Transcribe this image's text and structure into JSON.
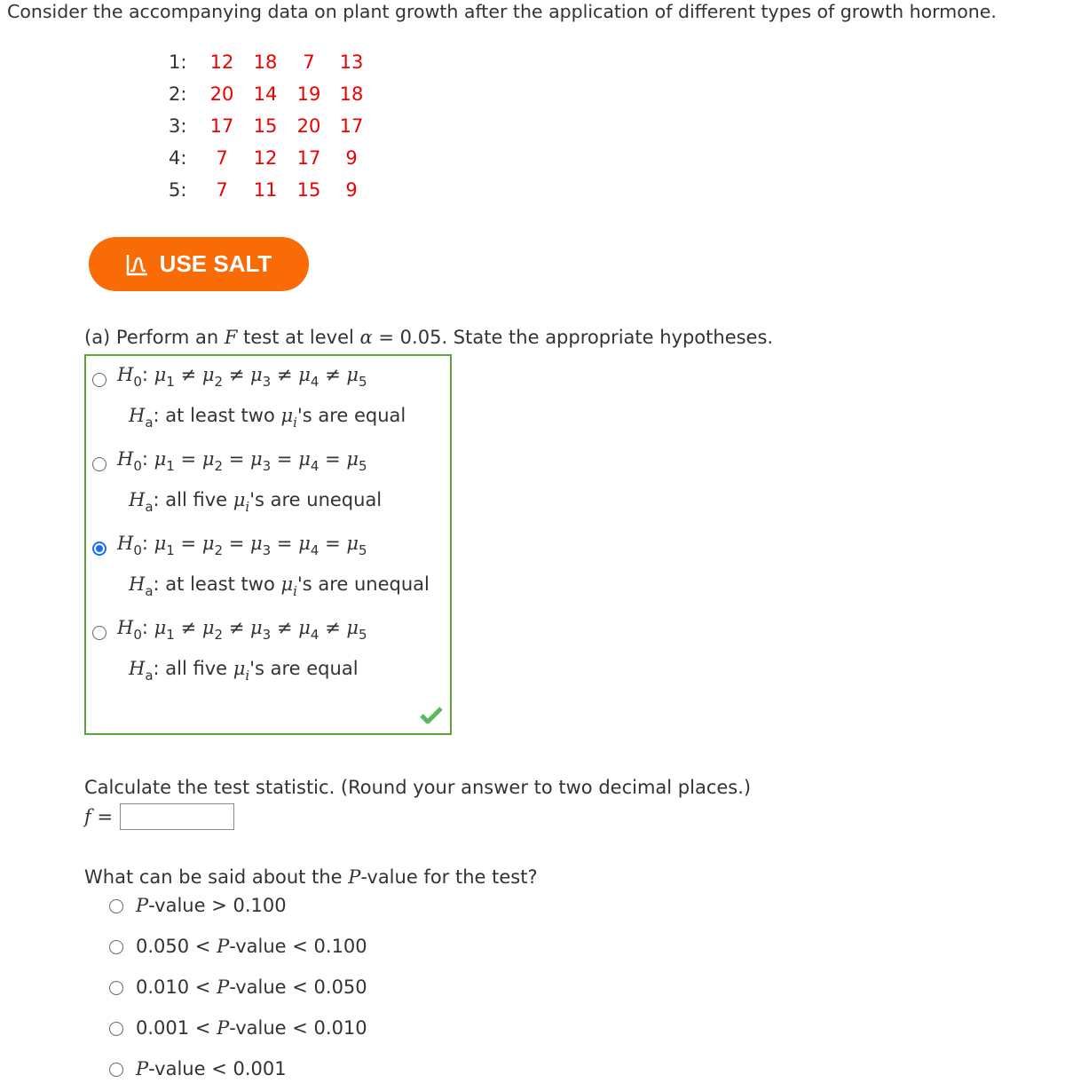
{
  "intro": "Consider the accompanying data on plant growth after the application of different types of growth hormone.",
  "table": [
    {
      "label": "1:",
      "values": [
        "12",
        "18",
        "7",
        "13"
      ]
    },
    {
      "label": "2:",
      "values": [
        "20",
        "14",
        "19",
        "18"
      ]
    },
    {
      "label": "3:",
      "values": [
        "17",
        "15",
        "20",
        "17"
      ]
    },
    {
      "label": "4:",
      "values": [
        "7",
        "12",
        "17",
        "9"
      ]
    },
    {
      "label": "5:",
      "values": [
        "7",
        "11",
        "15",
        "9"
      ]
    }
  ],
  "salt_button": "USE SALT",
  "part_a": {
    "prompt_pre": "(a) Perform an ",
    "prompt_f": "F",
    "prompt_mid": " test at level ",
    "alpha": "α",
    "prompt_post": " = 0.05. State the appropriate hypotheses.",
    "options": [
      {
        "rel": "≠",
        "ha_pre": "at least two ",
        "ha_post": "'s are equal",
        "selected": false
      },
      {
        "rel": "=",
        "ha_pre": "all five ",
        "ha_post": "'s are unequal",
        "selected": false
      },
      {
        "rel": "=",
        "ha_pre": "at least two ",
        "ha_post": "'s are unequal",
        "selected": true
      },
      {
        "rel": "≠",
        "ha_pre": "all five ",
        "ha_post": "'s are equal",
        "selected": false
      }
    ],
    "status": "correct",
    "check_color": "#5cb85c"
  },
  "stat": {
    "prompt": "Calculate the test statistic. (Round your answer to two decimal places.)",
    "label": "f",
    "eq": " =",
    "value": ""
  },
  "pvalue": {
    "prompt_pre": "What can be said about the ",
    "prompt_p": "P",
    "prompt_post": "-value for the test?",
    "options": [
      {
        "pre": "",
        "post": "-value > 0.100"
      },
      {
        "pre": "0.050 < ",
        "post": "-value < 0.100"
      },
      {
        "pre": "0.010 < ",
        "post": "-value < 0.050"
      },
      {
        "pre": "0.001 < ",
        "post": "-value < 0.010"
      },
      {
        "pre": "",
        "post": "-value < 0.001"
      }
    ]
  },
  "colors": {
    "accent": "#f96b06",
    "data": "#ee0000",
    "box_border": "#5fa33a",
    "radio_selected": "#1a6ef5"
  }
}
